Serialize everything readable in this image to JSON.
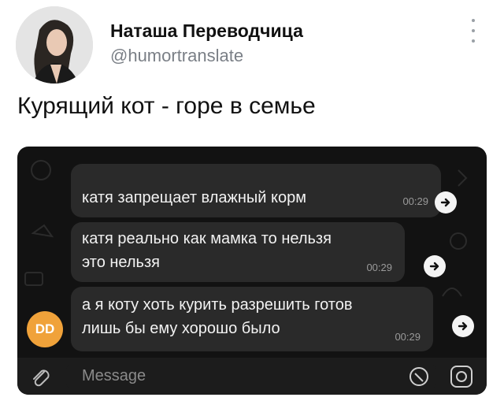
{
  "post": {
    "display_name": "Наташа Переводчица",
    "handle": "@humortranslate",
    "text": "Курящий кот - горе в семье"
  },
  "chat": {
    "messages": [
      {
        "lines": [
          "катя запрещает влажный корм"
        ],
        "time": "00:29"
      },
      {
        "lines": [
          "катя реально как мамка то нельзя",
          "это нельзя"
        ],
        "time": "00:29"
      },
      {
        "lines": [
          "а я коту хоть курить разрешить готов",
          "лишь бы ему хорошо было"
        ],
        "time": "00:29"
      }
    ],
    "sender_initials": "DD",
    "input_placeholder": "Message"
  },
  "colors": {
    "chat_bg": "#121212",
    "bubble_bg": "#2a2a2a",
    "avatar_badge": "#f0a23a"
  }
}
